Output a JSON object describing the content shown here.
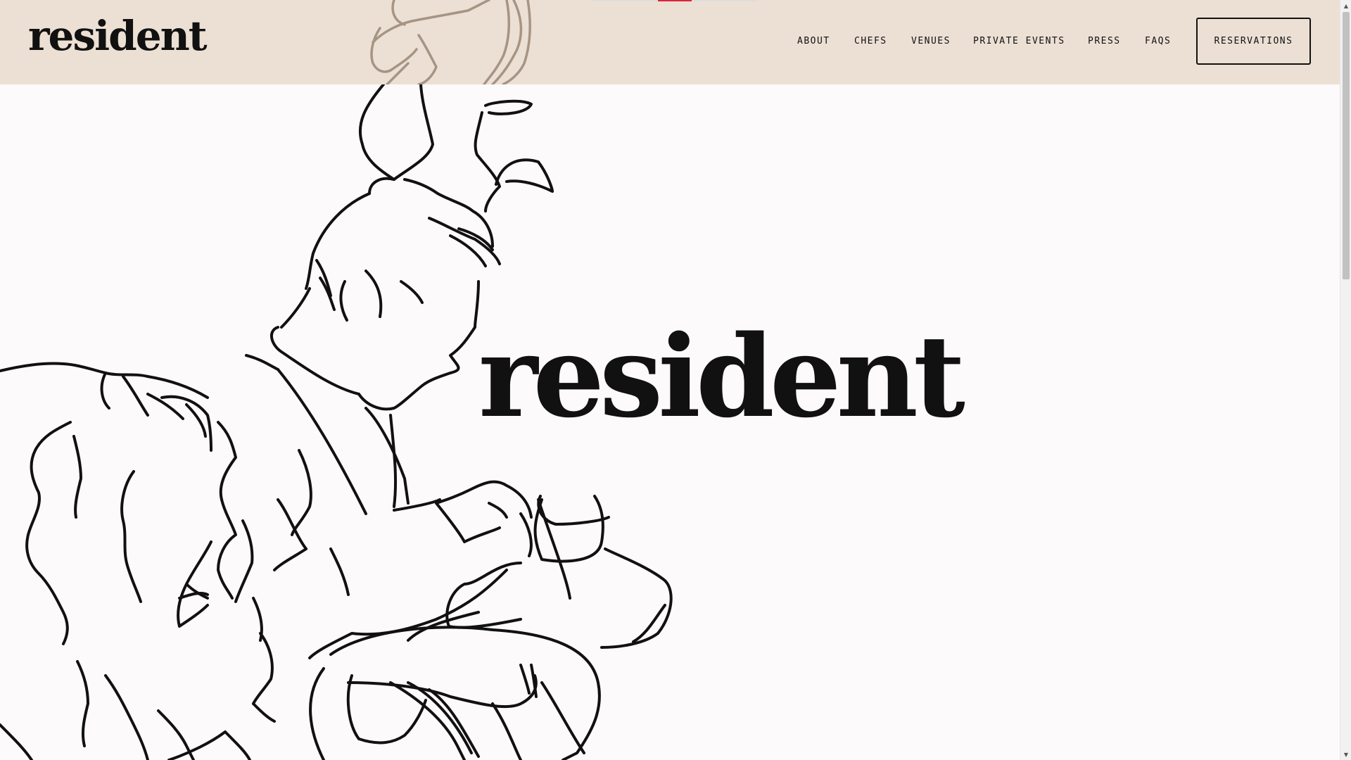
{
  "brand": {
    "logo": "resident",
    "hero_title": "resident"
  },
  "nav": {
    "items": [
      "ABOUT",
      "CHEFS",
      "VENUES",
      "PRIVATE EVENTS",
      "PRESS",
      "FAQS"
    ],
    "cta_label": "RESERVATIONS"
  },
  "slideshow": {
    "progress": 0.4
  },
  "scrollbar": {
    "up_icon": "triangle-up-icon",
    "down_icon": "triangle-down-icon"
  },
  "colors": {
    "header_bg": "#ece0d4",
    "page_bg": "#fdfafb",
    "ink": "#111111",
    "accent": "#d9243c"
  }
}
